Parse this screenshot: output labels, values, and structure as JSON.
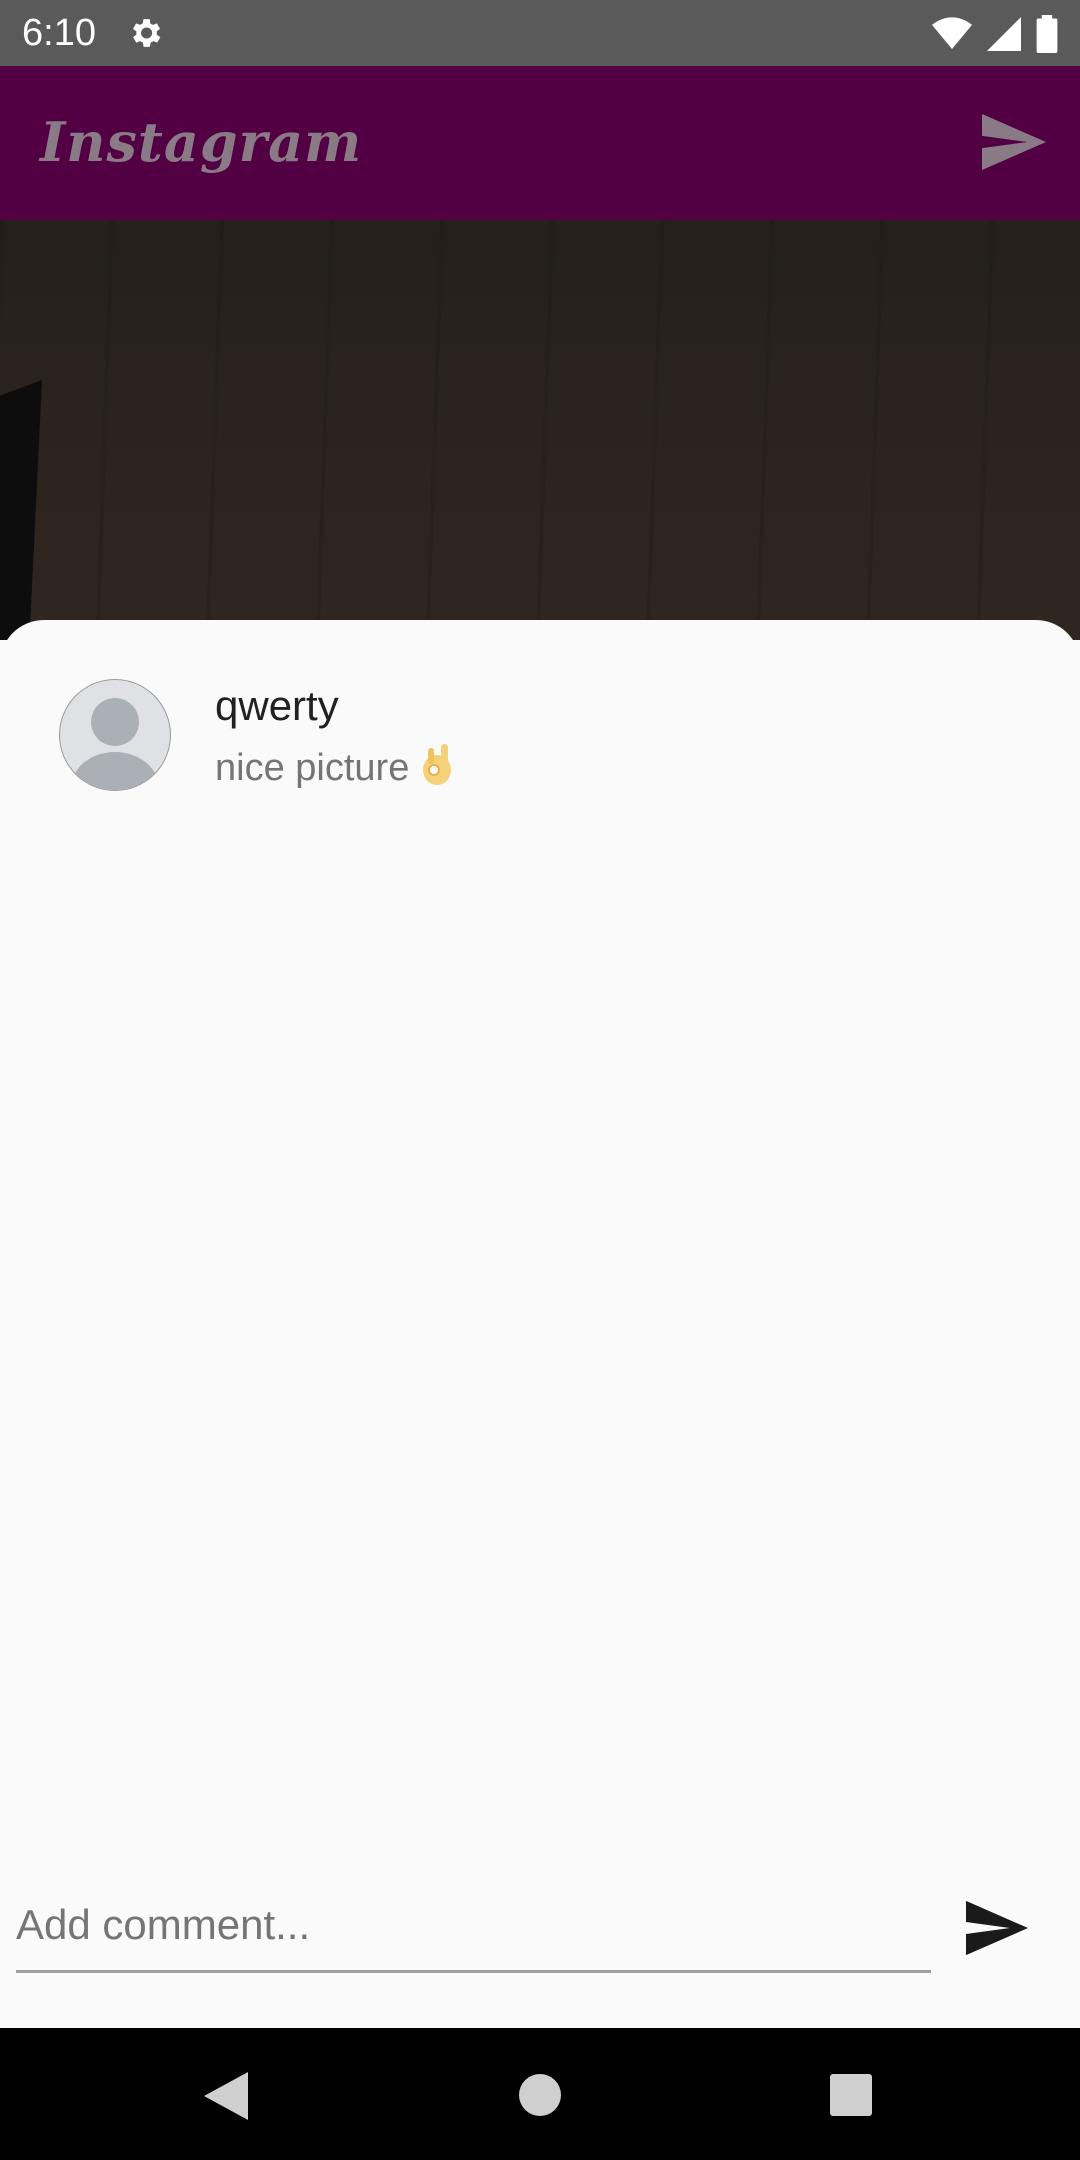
{
  "status_bar": {
    "time": "6:10",
    "icons": [
      "settings-icon",
      "wifi-icon",
      "cellular-signal-icon",
      "battery-icon"
    ]
  },
  "app_bar": {
    "title": "Instagram",
    "send_icon": "send-icon",
    "background_color": "#520043"
  },
  "comments_sheet": {
    "comments": [
      {
        "username": "qwerty",
        "text": "nice picture",
        "emoji_icon": "ok-hand-emoji-icon",
        "avatar_icon": "default-avatar-icon"
      }
    ],
    "input": {
      "placeholder": "Add comment...",
      "value": ""
    },
    "send_icon": "send-icon"
  },
  "nav_bar": {
    "buttons": [
      "back-icon",
      "home-icon",
      "recents-icon"
    ]
  }
}
